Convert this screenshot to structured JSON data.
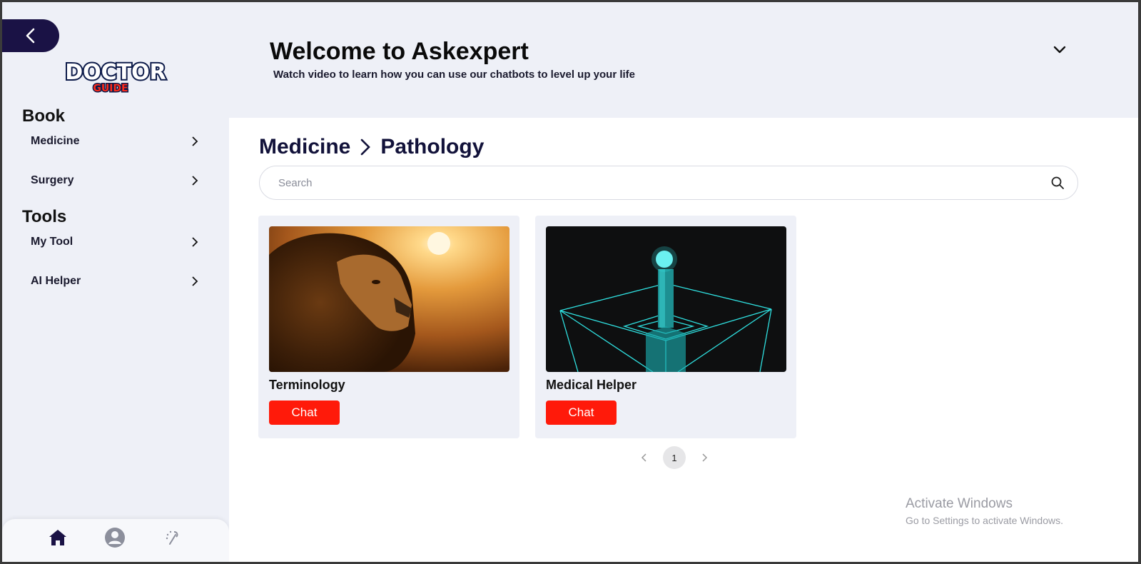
{
  "header": {
    "title": "Welcome to Askexpert",
    "subtitle": "Watch video to learn how you can use our chatbots to level up your life"
  },
  "logo": {
    "line1": "DOCTOR",
    "line2": "GUIDE"
  },
  "sidebar": {
    "sections": [
      {
        "title": "Book",
        "items": [
          {
            "label": "Medicine"
          },
          {
            "label": "Surgery"
          }
        ]
      },
      {
        "title": "Tools",
        "items": [
          {
            "label": "My Tool"
          },
          {
            "label": "AI Helper"
          }
        ]
      }
    ]
  },
  "breadcrumb": {
    "parent": "Medicine",
    "current": "Pathology"
  },
  "search": {
    "placeholder": "Search",
    "value": ""
  },
  "cards": [
    {
      "title": "Terminology",
      "button": "Chat",
      "image": "lion-sunset"
    },
    {
      "title": "Medical Helper",
      "button": "Chat",
      "image": "neon-pillar"
    }
  ],
  "pagination": {
    "current": "1"
  },
  "watermark": {
    "line1": "Activate Windows",
    "line2": "Go to Settings to activate Windows."
  },
  "bottom_nav": [
    "home-icon",
    "profile-icon",
    "magic-icon"
  ],
  "colors": {
    "accent": "#1a1245",
    "button": "#ff1a0a",
    "background": "#eef0f7"
  }
}
